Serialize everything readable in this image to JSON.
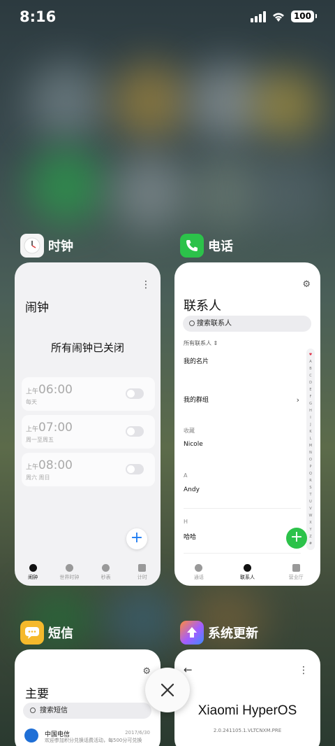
{
  "status_bar": {
    "time": "8:16",
    "battery": "100"
  },
  "clock_app": {
    "name": "时钟",
    "title": "闹钟",
    "status": "所有闹钟已关闭",
    "alarms": [
      {
        "ampm": "上午",
        "time": "06:00",
        "repeat": "每天"
      },
      {
        "ampm": "上午",
        "time": "07:00",
        "repeat": "周一至周五"
      },
      {
        "ampm": "上午",
        "time": "08:00",
        "repeat": "周六 周日"
      }
    ],
    "tabs": [
      "闹钟",
      "世界时钟",
      "秒表",
      "计时"
    ]
  },
  "phone_app": {
    "name": "电话",
    "title": "联系人",
    "search_placeholder": "搜索联系人",
    "all_contacts": "所有联系人 ⇕",
    "my_card": "我的名片",
    "my_groups": "我的群组",
    "favorites_header": "收藏",
    "favorite_contact": "Nicole",
    "section_a": "A",
    "contact_a": "Andy",
    "section_h": "H",
    "contact_h": "哈哈",
    "alphabet": [
      "♥",
      "A",
      "B",
      "C",
      "D",
      "E",
      "F",
      "G",
      "H",
      "I",
      "J",
      "K",
      "L",
      "M",
      "N",
      "O",
      "P",
      "Q",
      "R",
      "S",
      "T",
      "U",
      "V",
      "W",
      "X",
      "Y",
      "Z",
      "#"
    ],
    "tabs": [
      "通话",
      "联系人",
      "营业厅"
    ]
  },
  "sms_app": {
    "name": "短信",
    "title": "主要",
    "search_placeholder": "搜索短信",
    "message": {
      "sender": "中国电信",
      "date": "2017/6/30",
      "preview": "欢迎参加积分兑换话费活动，每500分可兑换"
    }
  },
  "update_app": {
    "name": "系统更新",
    "brand": "Xiaomi HyperOS",
    "version": "2.0.241105.1.VLTCNXM.PRE"
  },
  "colors": {
    "phone_green": "#2cc24a",
    "sms_yellow": "#f5b92c",
    "clock_fab_blue": "#1e7cf2"
  }
}
